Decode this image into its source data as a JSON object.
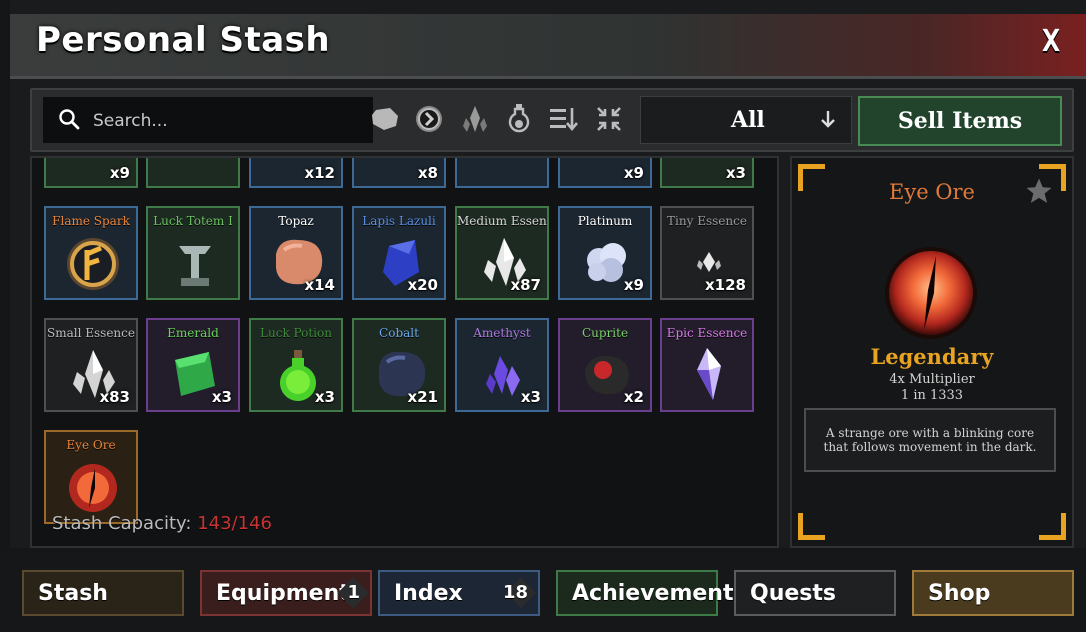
{
  "window": {
    "title": "Personal Stash",
    "close_label": "X"
  },
  "toolbar": {
    "search_placeholder": "Search...",
    "filter_value": "All",
    "sell_label": "Sell Items",
    "filter_icons": [
      "ore-filter-icon",
      "coin-filter-icon",
      "essence-filter-icon",
      "potion-filter-icon",
      "sort-icon",
      "collapse-icon"
    ]
  },
  "inventory": {
    "top_row_counts": [
      "x9",
      "",
      "x12",
      "x8",
      "",
      "x9",
      "x3"
    ],
    "items": [
      {
        "name": "Flame Spark",
        "count": "",
        "color": "#e8843a",
        "frame": "blue"
      },
      {
        "name": "Luck Totem I",
        "count": "",
        "color": "#6ac262",
        "frame": "green"
      },
      {
        "name": "Topaz",
        "count": "x14",
        "color": "#ffffff",
        "frame": "blue"
      },
      {
        "name": "Lapis Lazuli",
        "count": "x20",
        "color": "#5b8fe0",
        "frame": "blue"
      },
      {
        "name": "Medium Essence",
        "count": "x87",
        "color": "#d8d8d8",
        "frame": "green"
      },
      {
        "name": "Platinum",
        "count": "x9",
        "color": "#ffffff",
        "frame": "blue"
      },
      {
        "name": "Tiny Essence",
        "count": "x128",
        "color": "#9a9a9a",
        "frame": "gray"
      },
      {
        "name": "Small Essence",
        "count": "x83",
        "color": "#bcbcbc",
        "frame": "gray"
      },
      {
        "name": "Emerald",
        "count": "x3",
        "color": "#6ad45a",
        "frame": "purple"
      },
      {
        "name": "Luck Potion",
        "count": "x3",
        "color": "#3f8a3a",
        "frame": "green"
      },
      {
        "name": "Cobalt",
        "count": "x21",
        "color": "#6aa3e8",
        "frame": "green"
      },
      {
        "name": "Amethyst",
        "count": "x3",
        "color": "#b07ae0",
        "frame": "blue"
      },
      {
        "name": "Cuprite",
        "count": "x2",
        "color": "#7ad06a",
        "frame": "purple"
      },
      {
        "name": "Epic Essence",
        "count": "",
        "color": "#d87ae8",
        "frame": "purple"
      },
      {
        "name": "Eye Ore",
        "count": "",
        "color": "#e8843a",
        "frame": "orange"
      }
    ],
    "capacity_label": "Stash Capacity:",
    "capacity_value": "143/146"
  },
  "detail": {
    "name": "Eye Ore",
    "rarity": "Legendary",
    "multiplier": "4x Multiplier",
    "odds": "1 in 1333",
    "description": "A strange ore with a blinking core that follows movement in the dark."
  },
  "tabs": [
    {
      "label": "Stash",
      "badge": ""
    },
    {
      "label": "Equipments",
      "badge": "1"
    },
    {
      "label": "Index",
      "badge": "18"
    },
    {
      "label": "Achievements",
      "badge": ""
    },
    {
      "label": "Quests",
      "badge": ""
    },
    {
      "label": "Shop",
      "badge": ""
    }
  ]
}
